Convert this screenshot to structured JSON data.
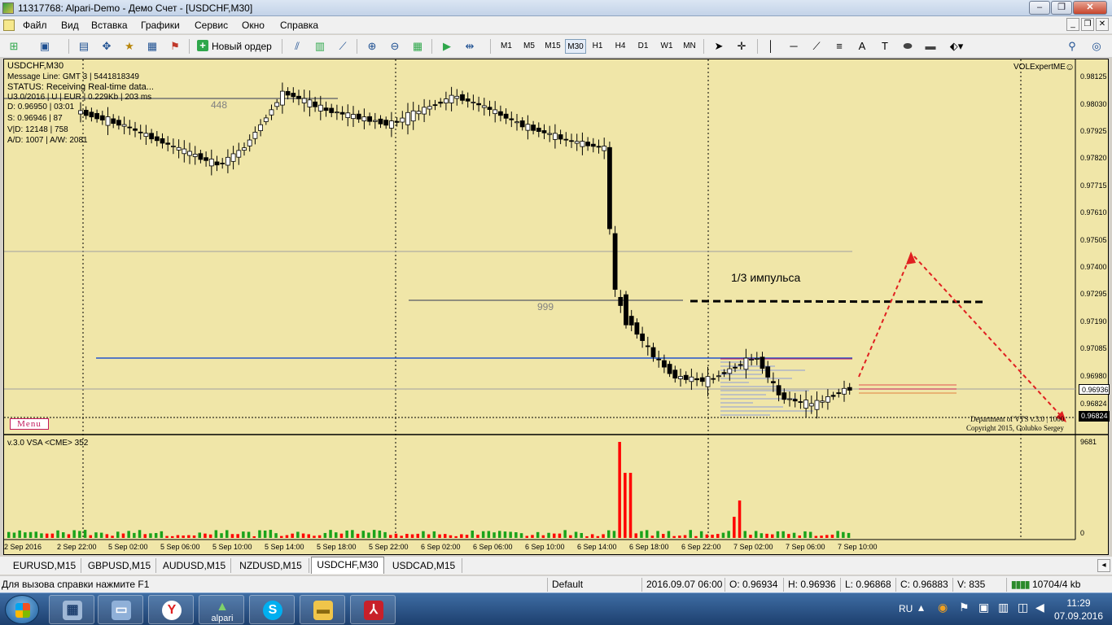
{
  "window": {
    "title": "11317768: Alpari-Demo - Демо Счет - [USDCHF,M30]"
  },
  "menu": {
    "items": [
      "Файл",
      "Вид",
      "Вставка",
      "Графики",
      "Сервис",
      "Окно",
      "Справка"
    ]
  },
  "toolbar": {
    "new_order_label": "Новый ордер",
    "timeframes": [
      "M1",
      "M5",
      "M15",
      "M30",
      "H1",
      "H4",
      "D1",
      "W1",
      "MN"
    ],
    "active_timeframe": "M30",
    "icons": [
      "new-chart-icon",
      "profiles-icon",
      "market-watch-icon",
      "navigator-icon",
      "terminal-icon",
      "strategy-tester-icon",
      "new-order-icon",
      "bar-chart-icon",
      "candlestick-icon",
      "line-chart-icon",
      "zoom-in-icon",
      "zoom-out-icon",
      "tile-windows-icon",
      "autoscroll-icon",
      "chart-shift-icon",
      "cursor-icon",
      "crosshair-icon",
      "vertical-line-icon",
      "horizontal-line-icon",
      "trendline-icon",
      "text-icon",
      "label-icon",
      "shapes-icon",
      "search-icon",
      "community-icon"
    ]
  },
  "chart": {
    "symbol_title": "USDCHF,M30",
    "info_lines": [
      "Message Line: GMT 3 | 5441818349",
      "STATUS:  Receiving Real-time data...",
      "U3.0/2016 | U | EUR | 0.229Kb | 203 ms",
      "D: 0.96950 | 03:01",
      "S: 0.96946 | 87",
      "V|D: 12148 | 758",
      "A/D: 1007 | A/W: 2081"
    ],
    "expert_label": "VOLExpertME",
    "menu_button": "Menu",
    "annotation_impulse": "1/3 импульса",
    "level_448": "448",
    "level_999": "999",
    "watermark_line1": "Department of VTS  v.3.0 | 1000",
    "watermark_line2": "Copyright 2015, Golubko Sergey",
    "price_axis": [
      "0.98125",
      "0.98030",
      "0.97925",
      "0.97820",
      "0.97715",
      "0.97610",
      "0.97505",
      "0.97400",
      "0.97295",
      "0.97190",
      "0.97085",
      "0.96980",
      "0.96936",
      "0.96824"
    ],
    "bid_price": "0.96936",
    "ask_price": "0.96824",
    "time_axis": [
      "2 Sep 2016",
      "2 Sep 22:00",
      "5 Sep 02:00",
      "5 Sep 06:00",
      "5 Sep 10:00",
      "5 Sep 14:00",
      "5 Sep 18:00",
      "5 Sep 22:00",
      "6 Sep 02:00",
      "6 Sep 06:00",
      "6 Sep 10:00",
      "6 Sep 14:00",
      "6 Sep 18:00",
      "6 Sep 22:00",
      "7 Sep 02:00",
      "7 Sep 06:00",
      "7 Sep 10:00"
    ],
    "colors": {
      "background": "#f0e6a8",
      "bull_candle": "#ffffff",
      "bear_candle": "#000000",
      "volume_up": "#1aa31a",
      "volume_climax": "#ff0000",
      "support_line": "#2255cc",
      "arrow": "#e02020"
    }
  },
  "volume_panel": {
    "title": "v.3.0 VSA <CME> 352",
    "scale_max": "9681",
    "scale_min": "0"
  },
  "tabs": [
    "EURUSD,M15",
    "GBPUSD,M15",
    "AUDUSD,M15",
    "NZDUSD,M15",
    "USDCHF,M30",
    "USDCAD,M15"
  ],
  "active_tab": "USDCHF,M30",
  "statusbar": {
    "help": "Для вызова справки нажмите F1",
    "profile": "Default",
    "datetime": "2016.09.07 06:00",
    "open": "O: 0.96934",
    "high": "H: 0.96936",
    "low": "L: 0.96868",
    "close": "C: 0.96883",
    "volume": "V: 835",
    "traffic": "10704/4 kb"
  },
  "taskbar": {
    "items": [
      "start-button",
      "calculator",
      "network-settings",
      "yandex-browser",
      "alpari",
      "skype",
      "file-explorer",
      "acrobat-reader"
    ],
    "alpari_label": "alpari",
    "language": "RU",
    "time": "11:29",
    "date": "07.09.2016"
  }
}
